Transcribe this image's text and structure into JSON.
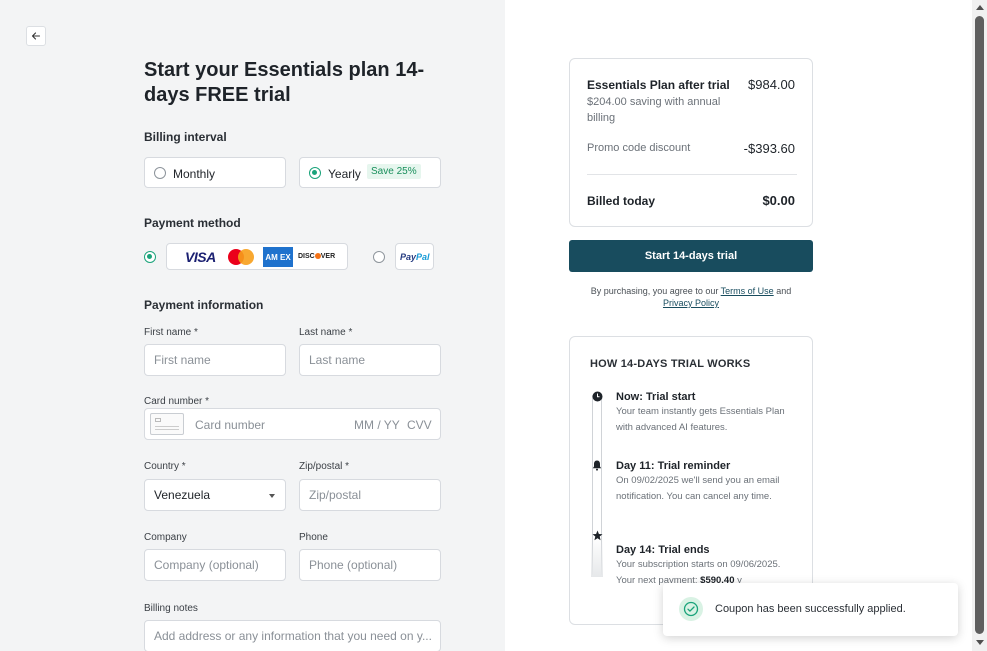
{
  "header": {
    "title": "Start your Essentials plan 14-days FREE trial"
  },
  "billing": {
    "label": "Billing interval",
    "options": [
      {
        "label": "Monthly",
        "selected": false
      },
      {
        "label": "Yearly",
        "selected": true,
        "badge": "Save 25%"
      }
    ]
  },
  "payment_method": {
    "label": "Payment method",
    "card_brands": {
      "visa": "VISA",
      "amex": "AM EX",
      "discover": "DISC VER"
    },
    "paypal": {
      "part1": "Pay",
      "part2": "Pal"
    }
  },
  "payment_info": {
    "label": "Payment information",
    "first_name": {
      "label": "First name",
      "required": "*",
      "placeholder": "First name"
    },
    "last_name": {
      "label": "Last name",
      "required": "*",
      "placeholder": "Last name"
    },
    "card_number": {
      "label": "Card number",
      "required": "*",
      "placeholder": "Card number",
      "expiry_placeholder": "MM / YY",
      "cvv_placeholder": "CVV"
    },
    "country": {
      "label": "Country",
      "required": "*",
      "value": "Venezuela"
    },
    "zip": {
      "label": "Zip/postal",
      "required": "*",
      "placeholder": "Zip/postal"
    },
    "company": {
      "label": "Company",
      "placeholder": "Company (optional)"
    },
    "phone": {
      "label": "Phone",
      "placeholder": "Phone (optional)"
    },
    "notes": {
      "label": "Billing notes",
      "placeholder": "Add address or any information that you need on y..."
    }
  },
  "summary": {
    "plan_label": "Essentials Plan after trial",
    "plan_price": "$984.00",
    "saving_text": "$204.00 saving with annual billing",
    "promo_label": "Promo code discount",
    "promo_value": "-$393.60",
    "total_label": "Billed today",
    "total_value": "$0.00"
  },
  "cta": {
    "label": "Start 14-days trial"
  },
  "terms": {
    "prefix": "By purchasing, you agree to our",
    "terms_link": "Terms of Use",
    "and": "and",
    "privacy_link": "Privacy Policy"
  },
  "how_it_works": {
    "title": "HOW 14-DAYS TRIAL WORKS",
    "steps": [
      {
        "title": "Now: Trial start",
        "desc": "Your team instantly gets Essentials Plan with advanced AI features."
      },
      {
        "title": "Day 11: Trial reminder",
        "desc": "On 09/02/2025 we'll send you an email notification. You can cancel any time."
      },
      {
        "title": "Day 14: Trial ends",
        "desc_part1": "Your subscription starts on 09/06/2025. Your next payment:",
        "desc_bold": "$590.40",
        "desc_part2": " y"
      }
    ]
  },
  "toast": {
    "message": "Coupon has been successfully applied."
  },
  "colors": {
    "accent": "#184c5e",
    "success": "#1aa37a",
    "left_bg": "#f3f4f5"
  },
  "icons": {
    "back": "arrow-left-icon",
    "toast": "check-circle-icon"
  }
}
